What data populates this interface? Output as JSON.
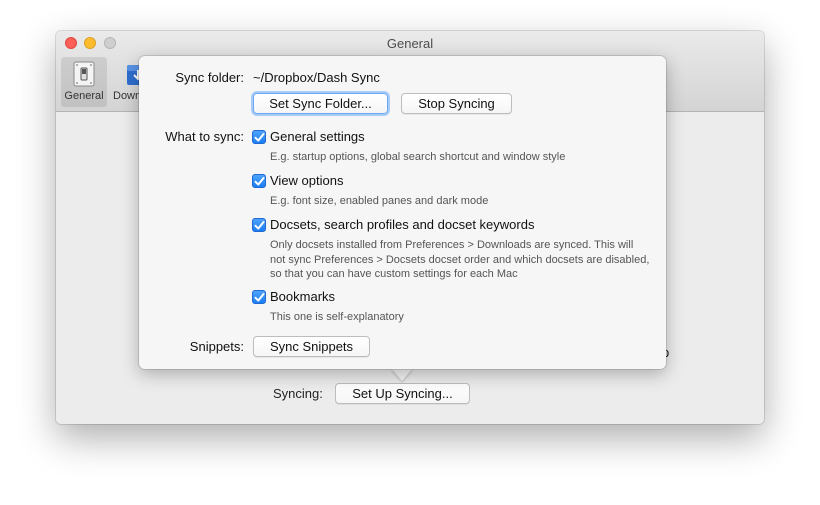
{
  "window": {
    "title": "General",
    "toolbar": [
      {
        "label": "General",
        "icon": "switch-icon"
      },
      {
        "label": "Downloads",
        "icon": "download-icon"
      }
    ]
  },
  "behind": {
    "right_text_fragment": "p",
    "syncing_label": "Syncing:",
    "setup_button": "Set Up Syncing..."
  },
  "popover": {
    "sync_folder_label": "Sync folder:",
    "sync_folder_value": "~/Dropbox/Dash Sync",
    "set_folder_button": "Set Sync Folder...",
    "stop_button": "Stop Syncing",
    "what_label": "What to sync:",
    "options": [
      {
        "label": "General settings",
        "checked": true,
        "desc": "E.g. startup options, global search shortcut and window style"
      },
      {
        "label": "View options",
        "checked": true,
        "desc": "E.g. font size, enabled panes and dark mode"
      },
      {
        "label": "Docsets, search profiles and docset keywords",
        "checked": true,
        "desc": "Only docsets installed from Preferences > Downloads are synced. This will not sync Preferences > Docsets docset order and which docsets are disabled, so that you can have custom settings for each Mac"
      },
      {
        "label": "Bookmarks",
        "checked": true,
        "desc": "This one is self-explanatory"
      }
    ],
    "snippets_label": "Snippets:",
    "snippets_button": "Sync Snippets"
  },
  "colors": {
    "checkbox": "#1d7ef3",
    "close": "#fc5f57",
    "minimize": "#fdbc2e",
    "focus_ring": "#6aa7f0"
  }
}
